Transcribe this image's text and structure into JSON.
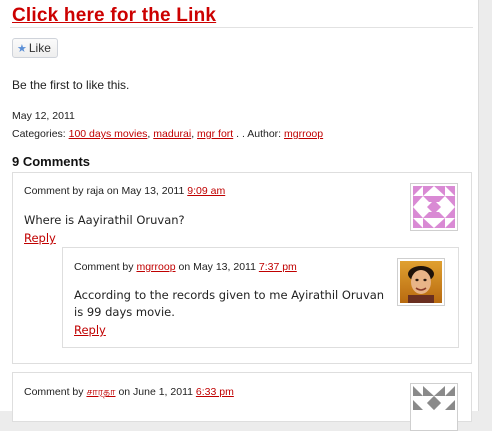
{
  "post": {
    "title_link": "Click here for the Link",
    "like_label": "Like",
    "first_like_text": "Be the first to like this.",
    "date": "May 12, 2011",
    "categories_label": "Categories:",
    "categories": [
      "100 days movies",
      "madurai",
      "mgr fort"
    ],
    "author_label": ". . Author:",
    "author": "mgrroop"
  },
  "comments": {
    "heading": "9 Comments",
    "items": [
      {
        "comment_by": "Comment by",
        "author": "raja",
        "on": "on May 13, 2011",
        "time": "9:09 am",
        "text": "Where is Aayirathil Oruvan?",
        "reply": "Reply"
      },
      {
        "comment_by": "Comment by",
        "author": "mgrroop",
        "on": "on May 13, 2011",
        "time": "7:37 pm",
        "text": "According to the records given to me Ayirathil Oruvan is 99 days movie.",
        "reply": "Reply"
      },
      {
        "comment_by": "Comment by",
        "author": "சாரதா",
        "on": "on June 1, 2011",
        "time": "6:33 pm"
      }
    ]
  },
  "colors": {
    "link": "#c00000",
    "identicon_pink": "#d98ad4",
    "identicon_gray": "#8a8a8a"
  }
}
